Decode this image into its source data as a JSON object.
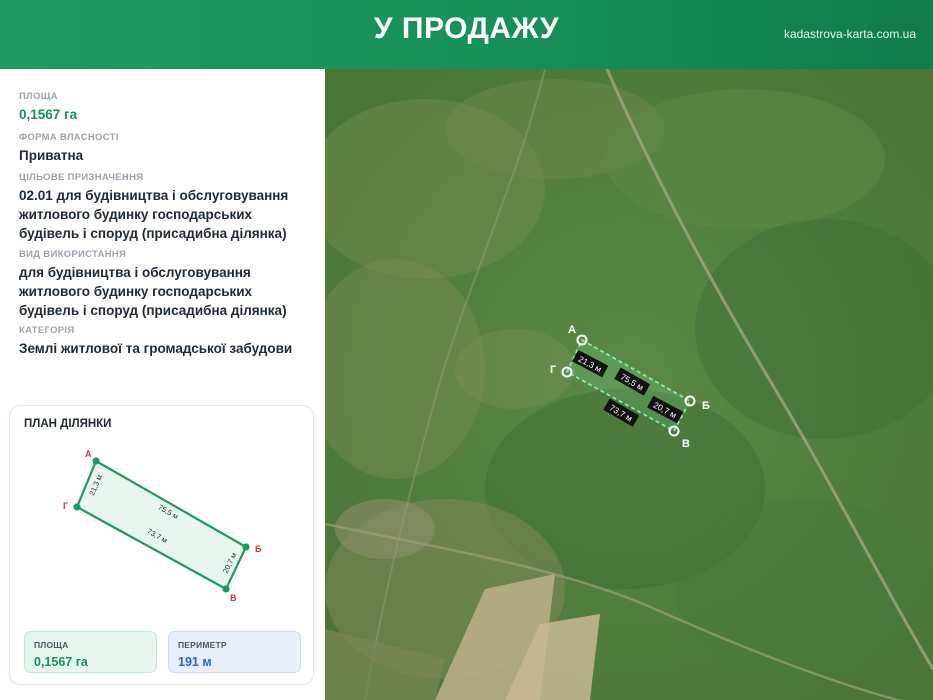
{
  "header": {
    "title": "У ПРОДАЖУ",
    "site": "kadastrova-karta.com.ua"
  },
  "info": {
    "area_label": "ПЛОЩА",
    "area_value": "0,1567 га",
    "ownership_label": "ФОРМА ВЛАСНОСТІ",
    "ownership_value": "Приватна",
    "purpose_label": "ЦІЛЬОВЕ ПРИЗНАЧЕННЯ",
    "purpose_value_1": "02.01 для будівництва і обслуговування",
    "purpose_value_2": "житлового будинку господарських",
    "purpose_value_3": "будівель і споруд (присадибна ділянка)",
    "usage_label": "ВИД ВИКОРИСТАННЯ",
    "usage_value_1": "для будівництва і обслуговування",
    "usage_value_2": "житлового будинку господарських",
    "usage_value_3": "будівель і споруд (присадибна ділянка)",
    "category_label": "КАТЕГОРІЯ",
    "category_value": "Землі житлової та громадської забудови"
  },
  "plan": {
    "title": "ПЛАН ДІЛЯНКИ",
    "vertices": [
      "А",
      "Б",
      "В",
      "Г"
    ],
    "sides": {
      "ab": "75,5 м",
      "bv": "20,7 м",
      "vg": "73,7 м",
      "ga": "21,3 м"
    },
    "area_label": "ПЛОЩА",
    "area_value": "0,1567 га",
    "perimeter_label": "ПЕРИМЕТР",
    "perimeter_value": "191 м"
  },
  "map": {
    "vertices": [
      "А",
      "Б",
      "В",
      "Г"
    ],
    "sides": {
      "ab": "75,5 м",
      "bv": "20,7 м",
      "vg": "73,7 м",
      "ga": "21,3 м"
    }
  },
  "colors": {
    "accent_green": "#16905a",
    "perimeter_blue": "#2563eb",
    "vertex_red": "#d9363e"
  }
}
